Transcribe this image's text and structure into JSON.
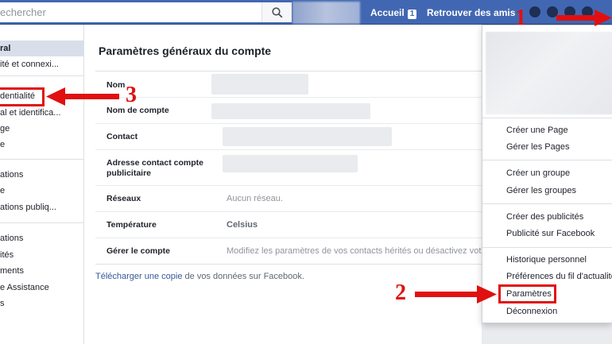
{
  "topbar": {
    "search_placeholder": "echercher",
    "home_label": "Accueil",
    "home_badge": "1",
    "find_friends_label": "Retrouver des amis"
  },
  "sidebar": {
    "items": [
      {
        "label": "ral"
      },
      {
        "label": "ité et connexi..."
      },
      {
        "label": "dentialité"
      },
      {
        "label": "al et identifica..."
      },
      {
        "label": "ge"
      },
      {
        "label": "e"
      },
      {
        "label": "ations"
      },
      {
        "label": "e"
      },
      {
        "label": "ations publiq..."
      },
      {
        "label": "ations"
      },
      {
        "label": "ités"
      },
      {
        "label": "ments"
      },
      {
        "label": "e Assistance"
      },
      {
        "label": "s"
      }
    ]
  },
  "main": {
    "title": "Paramètres généraux du compte",
    "rows": [
      {
        "label": "Nom",
        "value": ""
      },
      {
        "label": "Nom de compte",
        "value": ""
      },
      {
        "label": "Contact",
        "value": ""
      },
      {
        "label": "Adresse contact compte publicitaire",
        "value": ""
      },
      {
        "label": "Réseaux",
        "value": "Aucun réseau."
      },
      {
        "label": "Température",
        "value": "Celsius"
      },
      {
        "label": "Gérer le compte",
        "value": "Modifiez les paramètres de vos contacts hérités ou désactivez votre"
      }
    ],
    "download_link": "Télécharger une copie",
    "download_rest": " de vos données sur Facebook."
  },
  "dropdown": {
    "items": [
      "Créer une Page",
      "Gérer les Pages",
      "Créer un groupe",
      "Gérer les groupes",
      "Créer des publicités",
      "Publicité sur Facebook",
      "Historique personnel",
      "Préférences du fil d'actualité",
      "Paramètres",
      "Déconnexion"
    ]
  },
  "annotations": {
    "step1": "1",
    "step2": "2",
    "step3": "3",
    "color": "#e01010"
  },
  "colors": {
    "brand": "#4267b2",
    "link": "#365899"
  }
}
